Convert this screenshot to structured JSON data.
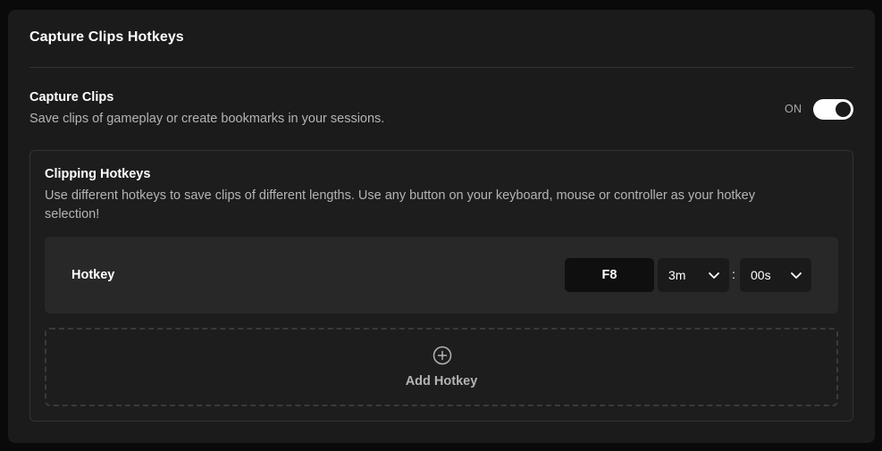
{
  "panel": {
    "title": "Capture Clips Hotkeys"
  },
  "capture_clips": {
    "title": "Capture Clips",
    "description": "Save clips of gameplay or create bookmarks in your sessions.",
    "toggle_label": "ON",
    "enabled": true
  },
  "clipping_hotkeys": {
    "title": "Clipping Hotkeys",
    "description": "Use different hotkeys to save clips of different lengths. Use any button on your keyboard, mouse or controller as your hotkey selection!",
    "hotkeys": [
      {
        "label": "Hotkey",
        "key": "F8",
        "minutes": "3m",
        "separator": ":",
        "seconds": "00s"
      }
    ],
    "add_label": "Add Hotkey"
  },
  "icons": {
    "dropdown": "chevron-down-icon",
    "add": "plus-circle-icon"
  },
  "colors": {
    "background": "#0a0a0a",
    "panel": "#1b1b1b",
    "row": "#282828",
    "key_button": "#0f0f0f",
    "text_primary": "#ffffff",
    "text_secondary": "#b4b4b4",
    "toggle_on": "#ffffff"
  }
}
